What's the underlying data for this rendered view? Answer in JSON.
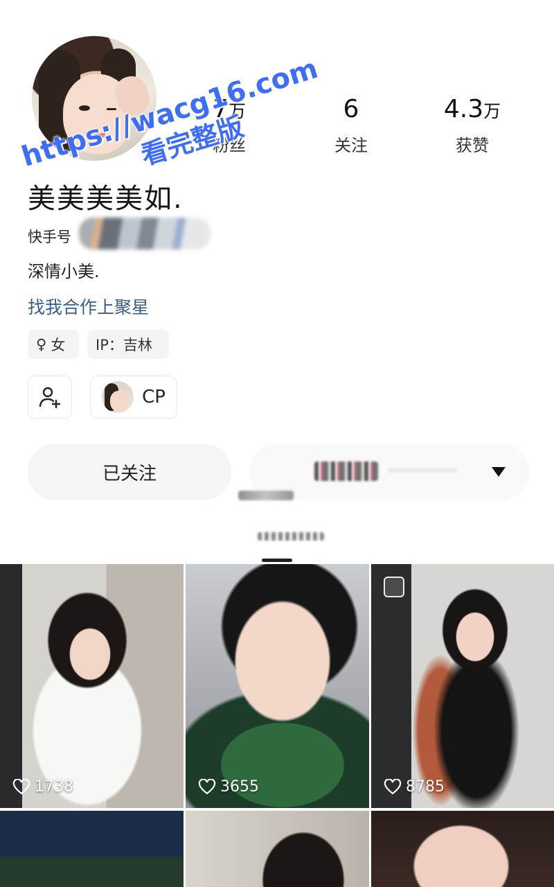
{
  "profile": {
    "nickname": "美美美美如.",
    "kuaishou_label": "快手号",
    "bio": "深情小美.",
    "cooperation_link": "找我合作上聚星",
    "gender_symbol": "♀",
    "gender": "女",
    "ip_label": "IP：吉林"
  },
  "stats": {
    "fans": {
      "value": "7",
      "unit": "万",
      "label": "粉丝"
    },
    "following": {
      "value": "6",
      "unit": "",
      "label": "关注"
    },
    "likes": {
      "value": "4.3",
      "unit": "万",
      "label": "获赞"
    }
  },
  "actions": {
    "cp_label": "CP",
    "followed_label": "已关注"
  },
  "watermark": {
    "url": "https://wacg16.com",
    "text": "看完整版"
  },
  "grid": {
    "items": [
      {
        "likes": "1738",
        "photo": false
      },
      {
        "likes": "3655",
        "photo": false
      },
      {
        "likes": "8785",
        "photo": true
      }
    ]
  },
  "colors": {
    "link": "#3a5e86",
    "watermark": "#3f6ef0",
    "button_bg": "#f5f5f6"
  },
  "icons": [
    "add-friend-icon",
    "heart-icon",
    "photo-icon",
    "dropdown-icon"
  ]
}
